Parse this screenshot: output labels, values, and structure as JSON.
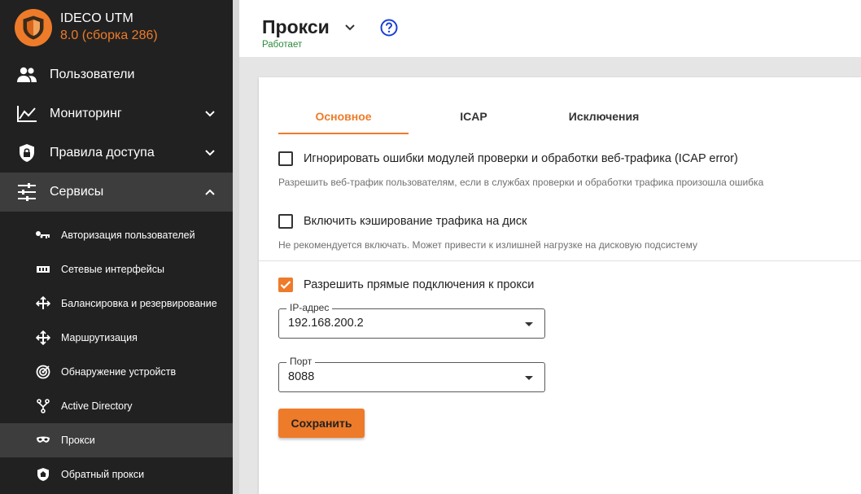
{
  "brand": {
    "name": "IDECO UTM",
    "version": "8.0 (сборка 286)"
  },
  "nav": [
    {
      "label": "Пользователи",
      "icon": "users-icon"
    },
    {
      "label": "Мониторинг",
      "icon": "chart-line-icon"
    },
    {
      "label": "Правила доступа",
      "icon": "lock-shield-icon"
    },
    {
      "label": "Сервисы",
      "icon": "sliders-icon"
    }
  ],
  "services_items": [
    {
      "label": "Авторизация пользователей",
      "icon": "key-icon"
    },
    {
      "label": "Сетевые интерфейсы",
      "icon": "ethernet-icon"
    },
    {
      "label": "Балансировка и резервирование",
      "icon": "arrows-split-icon"
    },
    {
      "label": "Маршрутизация",
      "icon": "cross-arrows-icon"
    },
    {
      "label": "Обнаружение устройств",
      "icon": "radar-icon"
    },
    {
      "label": "Active Directory",
      "icon": "tree-icon"
    },
    {
      "label": "Прокси",
      "icon": "mask-icon"
    },
    {
      "label": "Обратный прокси",
      "icon": "home-shield-icon"
    }
  ],
  "header": {
    "title": "Прокси",
    "status": "Работает"
  },
  "tabs": [
    "Основное",
    "ICAP",
    "Исключения"
  ],
  "options": {
    "icap_error": {
      "label": "Игнорировать ошибки модулей проверки и обработки веб-трафика (ICAP error)",
      "hint": "Разрешить веб-трафик пользователям, если в службах проверки и обработки трафика произошла ошибка",
      "checked": false
    },
    "disk_cache": {
      "label": "Включить кэширование трафика на диск",
      "hint": "Не рекомендуется включать. Может привести к излишней нагрузке на дисковую подсистему",
      "checked": false
    },
    "direct_connect": {
      "label": "Разрешить прямые подключения к прокси",
      "checked": true
    }
  },
  "fields": {
    "ip": {
      "label": "IP-адрес",
      "value": "192.168.200.2"
    },
    "port": {
      "label": "Порт",
      "value": "8088"
    }
  },
  "save_label": "Сохранить",
  "colors": {
    "accent": "#ee7b2a",
    "sidebar": "#212121",
    "status": "#2e8b3e",
    "help": "#1a3fd6"
  }
}
